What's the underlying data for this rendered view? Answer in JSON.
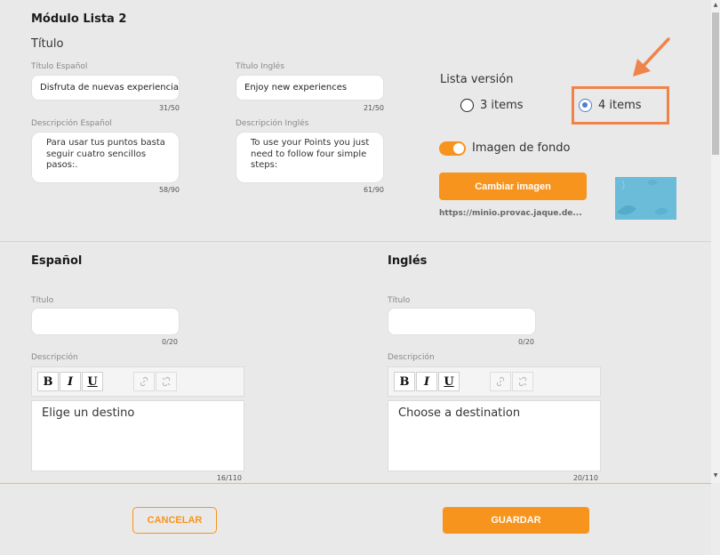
{
  "module": {
    "heading": "Módulo Lista 2",
    "titulo_heading": "Título"
  },
  "title_es": {
    "label": "Título Español",
    "value": "Disfruta de nuevas experiencias",
    "counter": "31/50"
  },
  "title_en": {
    "label": "Título Inglés",
    "value": "Enjoy new experiences",
    "counter": "21/50"
  },
  "desc_es": {
    "label": "Descripción Español",
    "value": "Para usar tus puntos basta seguir cuatro sencillos pasos:.",
    "counter": "58/90"
  },
  "desc_en": {
    "label": "Descripción Inglés",
    "value": "To use your Points you just need to follow four simple steps:",
    "counter": "61/90"
  },
  "lista_version": {
    "label": "Lista versión",
    "options": [
      {
        "label": "3 items",
        "checked": false
      },
      {
        "label": "4 items",
        "checked": true
      }
    ]
  },
  "background": {
    "toggle_label": "Imagen de fondo",
    "toggle_on": true,
    "change_button": "Cambiar imagen",
    "url": "https://minio.provac.jaque.de..."
  },
  "espanol": {
    "heading": "Español",
    "titulo_label": "Título",
    "titulo_value": "",
    "titulo_counter": "0/20",
    "desc_label": "Descripción",
    "desc_value": "Elige un destino",
    "desc_counter": "16/110"
  },
  "ingles": {
    "heading": "Inglés",
    "titulo_label": "Título",
    "titulo_value": "",
    "titulo_counter": "0/20",
    "desc_label": "Descripción",
    "desc_value": "Choose a destination",
    "desc_counter": "20/110"
  },
  "toolbar": {
    "bold": "B",
    "italic": "I",
    "underline": "U"
  },
  "footer": {
    "cancel": "CANCELAR",
    "save": "GUARDAR"
  },
  "colors": {
    "accent": "#f7941d",
    "highlight": "#f0834a",
    "radio": "#4a7fd4"
  },
  "icons": [
    "link-icon",
    "unlink-icon",
    "arrow-annotation-icon",
    "leaf-pattern-icon"
  ]
}
